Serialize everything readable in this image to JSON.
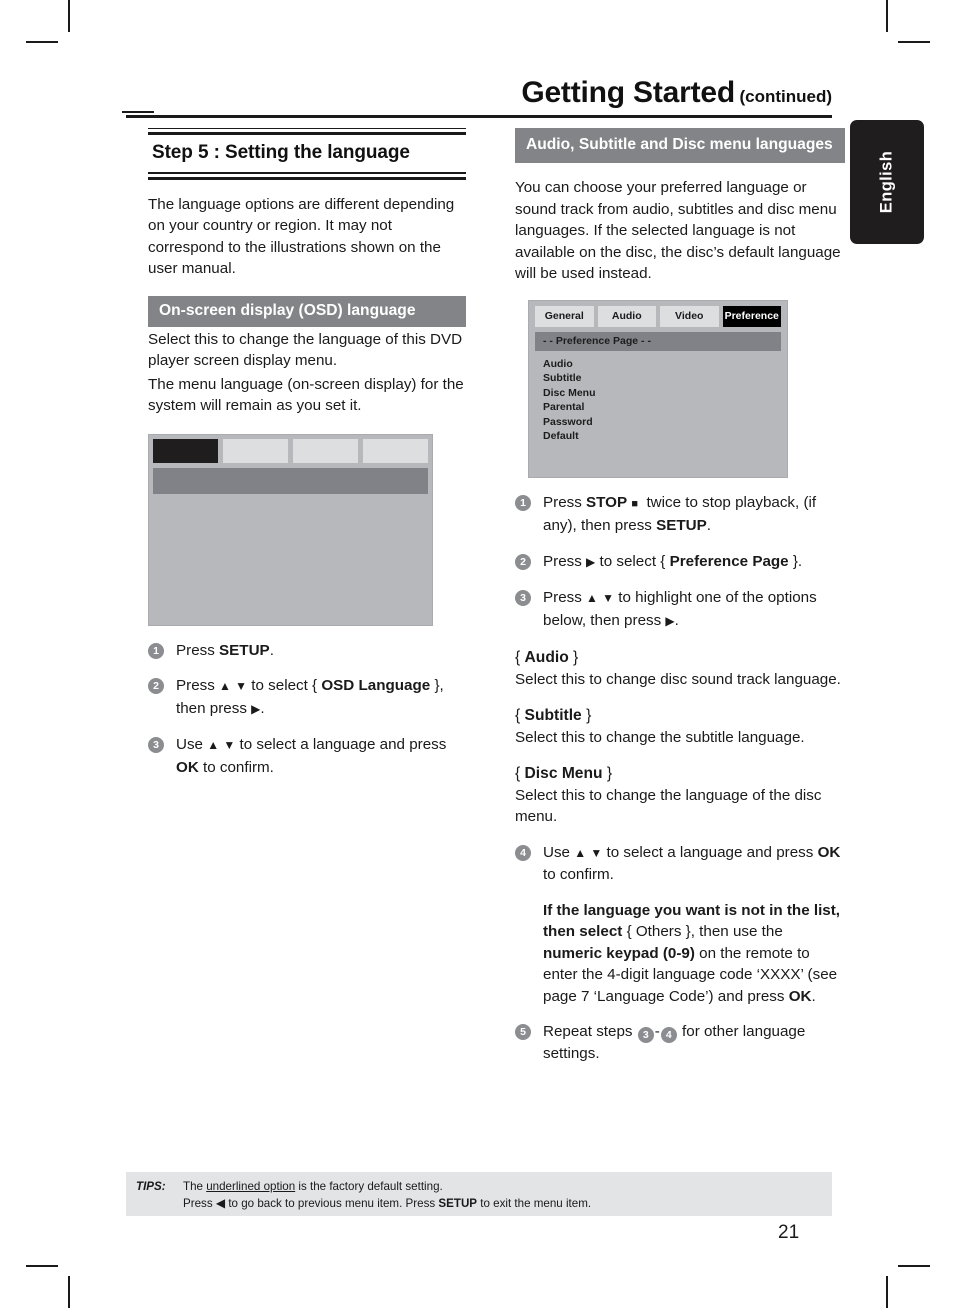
{
  "header": {
    "title": "Getting Started",
    "continued": "(continued)"
  },
  "side_tab": {
    "label": "English"
  },
  "left_column": {
    "step_heading": "Step 5 : Setting the language",
    "intro": "The language options are different depending on your country or region. It may not correspond to the illustrations shown on the user manual.",
    "osd_section": {
      "bar_label": "On-screen display (OSD) language",
      "paragraph1": "Select this to change the language of this DVD player screen display menu.",
      "paragraph2": "The menu language (on-screen display) for the system will remain as you set it."
    },
    "osd_screenshot": {
      "tabs": [
        "",
        "",
        "",
        ""
      ],
      "active_tab_index": 0,
      "title_bar": ""
    },
    "steps": [
      {
        "num": "1",
        "text_html": "Press <span class=\"bold\">SETUP</span>."
      },
      {
        "num": "2",
        "text_html": "Press <span class=\"gly\">&#9650;</span> <span class=\"gly\">&#9660;</span> to select { <span class=\"bold\">OSD Language</span> }, then press <span class=\"gly\">&#9654;</span>."
      },
      {
        "num": "3",
        "text_html": "Use <span class=\"gly\">&#9650;</span> <span class=\"gly\">&#9660;</span> to select a language and press <span class=\"bold\">OK</span> to confirm."
      }
    ]
  },
  "right_column": {
    "section_bar": "Audio, Subtitle and Disc menu languages",
    "intro": "You can choose your preferred language or sound track from audio, subtitles and disc menu languages. If the selected language is not available on the disc, the disc’s default language will be used instead.",
    "pref_screenshot": {
      "tabs": [
        "General",
        "Audio",
        "Video",
        "Preference"
      ],
      "active_tab": "Preference",
      "page_bar": "- -  Preference Page   - -",
      "items": [
        "Audio",
        "Subtitle",
        "Disc Menu",
        "Parental",
        "Password",
        "Default"
      ]
    },
    "steps": [
      {
        "num": "1",
        "text_html": "Press <span class=\"bold\">STOP</span> <span class=\"gly-sq\">&#9632;</span>&nbsp; twice to stop playback, (if any), then press <span class=\"bold\">SETUP</span>."
      },
      {
        "num": "2",
        "text_html": "Press <span class=\"gly\">&#9654;</span> to select { <span class=\"bold\">Preference Page</span> }."
      },
      {
        "num": "3",
        "text_html": "Press <span class=\"gly\">&#9650;</span> <span class=\"gly\">&#9660;</span> to highlight one of the options below, then press <span class=\"gly\">&#9654;</span>."
      }
    ],
    "definitions": [
      {
        "term": "Audio",
        "desc": "Select this to change disc sound track language."
      },
      {
        "term": "Subtitle",
        "desc": "Select this to change the subtitle language."
      },
      {
        "term": "Disc Menu",
        "desc": "Select this to change the language of the disc menu."
      }
    ],
    "steps_cont": [
      {
        "num": "4",
        "text_html": "Use <span class=\"gly\">&#9650;</span> <span class=\"gly\">&#9660;</span> to select a language and press <span class=\"bold\">OK</span> to confirm."
      }
    ],
    "note_html": "<span class=\"bold\">If the language you want is not in the list, then select</span> { Others }, then use the <span class=\"bold\">numeric keypad (0-9)</span> on the remote to enter the 4-digit language code ‘XXXX’ (see page 7 ‘Language Code’) and press <span class=\"bold\">OK</span>.",
    "step5": {
      "num": "5",
      "prefix": "Repeat steps",
      "ref_a": "3",
      "dash": "-",
      "ref_b": "4",
      "suffix": "for other language settings."
    }
  },
  "tips": {
    "label": "TIPS:",
    "line1_html": "The <span class=\"uline\">underlined option</span> is the factory default setting.",
    "line2_html": "Press <span class=\"gly\">&#9664;</span> to go back to previous menu item. Press <span class=\"bold\">SETUP</span> to exit the menu item."
  },
  "page_number": "21",
  "colors": {
    "section_bar_grey": "#828487",
    "screenshot_bg": "#b6b8bc",
    "tips_bg": "#e3e4e6",
    "tab_black": "#201d1e"
  }
}
